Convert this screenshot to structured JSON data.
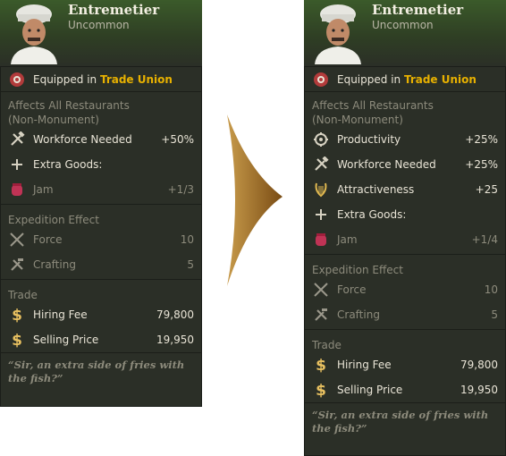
{
  "left_card": {
    "name": "Entremetier",
    "rarity": "Uncommon",
    "equipped_prefix": "Equipped in ",
    "equipped_place": "Trade Union",
    "affects_line1": "Affects All Restaurants",
    "affects_line2": "(Non-Monument)",
    "stats": [
      {
        "icon": "hammer-wrench-icon",
        "label": "Workforce Needed",
        "value": "+50%"
      },
      {
        "icon": "plus-icon",
        "label": "Extra Goods:",
        "value": ""
      }
    ],
    "goods": [
      {
        "icon": "jam-icon",
        "label": "Jam",
        "value": "+1/3"
      }
    ],
    "expedition_title": "Expedition Effect",
    "expedition": [
      {
        "icon": "crossed-swords-icon",
        "label": "Force",
        "value": "10"
      },
      {
        "icon": "crafting-tools-icon",
        "label": "Crafting",
        "value": "5"
      }
    ],
    "trade_title": "Trade",
    "trade": [
      {
        "icon": "dollar-icon",
        "label": "Hiring Fee",
        "value": "79,800"
      },
      {
        "icon": "dollar-icon",
        "label": "Selling Price",
        "value": "19,950"
      }
    ],
    "quote_line1": "“Sir, an extra side of fries with",
    "quote_line2": "the fish?”"
  },
  "right_card": {
    "name": "Entremetier",
    "rarity": "Uncommon",
    "equipped_prefix": "Equipped in ",
    "equipped_place": "Trade Union",
    "affects_line1": "Affects All Restaurants",
    "affects_line2": "(Non-Monument)",
    "stats": [
      {
        "icon": "gear-icon",
        "label": "Productivity",
        "value": "+25%"
      },
      {
        "icon": "hammer-wrench-icon",
        "label": "Workforce Needed",
        "value": "+25%"
      },
      {
        "icon": "lyre-icon",
        "label": "Attractiveness",
        "value": "+25"
      },
      {
        "icon": "plus-icon",
        "label": "Extra Goods:",
        "value": ""
      }
    ],
    "goods": [
      {
        "icon": "jam-icon",
        "label": "Jam",
        "value": "+1/4"
      }
    ],
    "expedition_title": "Expedition Effect",
    "expedition": [
      {
        "icon": "crossed-swords-icon",
        "label": "Force",
        "value": "10"
      },
      {
        "icon": "crafting-tools-icon",
        "label": "Crafting",
        "value": "5"
      }
    ],
    "trade_title": "Trade",
    "trade": [
      {
        "icon": "dollar-icon",
        "label": "Hiring Fee",
        "value": "79,800"
      },
      {
        "icon": "dollar-icon",
        "label": "Selling Price",
        "value": "19,950"
      }
    ],
    "quote_line1": "“Sir, an extra side of fries with",
    "quote_line2": "the fish?”"
  },
  "colors": {
    "card_bg": "#2b2f27",
    "header_green": "#3b5a2a",
    "gold_text": "#e8b100",
    "dim_text": "#8d8b7c",
    "arrow": "#8a5a1a"
  }
}
